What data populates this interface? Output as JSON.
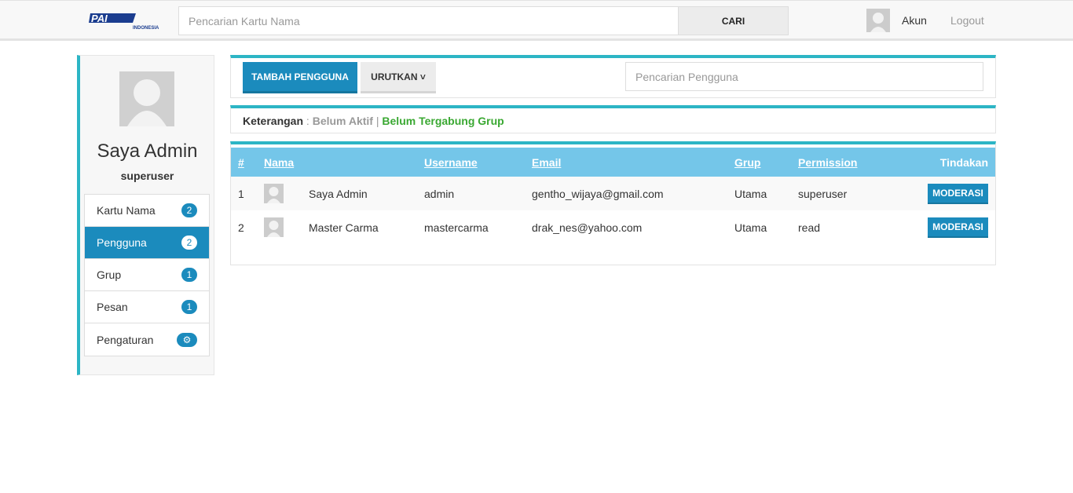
{
  "header": {
    "logo_text": "PAI",
    "logo_sub": "INDONESIA",
    "search_placeholder": "Pencarian Kartu Nama",
    "search_button": "CARI",
    "account_label": "Akun",
    "logout_label": "Logout"
  },
  "profile": {
    "name": "Saya Admin",
    "role": "superuser"
  },
  "sidebar": {
    "items": [
      {
        "label": "Kartu Nama",
        "badge": "2"
      },
      {
        "label": "Pengguna",
        "badge": "2",
        "active": true
      },
      {
        "label": "Grup",
        "badge": "1"
      },
      {
        "label": "Pesan",
        "badge": "1"
      },
      {
        "label": "Pengaturan",
        "badge": "⚙"
      }
    ]
  },
  "toolbar": {
    "add_user_label": "TAMBAH PENGGUNA",
    "sort_label": "URUTKAN ˅",
    "search_placeholder": "Pencarian Pengguna"
  },
  "legend": {
    "label": "Keterangan",
    "separator_colon": " : ",
    "inactive": "Belum Aktif",
    "separator_bar": " | ",
    "no_group": "Belum Tergabung Grup"
  },
  "table": {
    "headers": [
      "#",
      "Nama",
      "Username",
      "Email",
      "Grup",
      "Permission",
      "Tindakan"
    ],
    "rows": [
      {
        "no": "1",
        "name": "Saya Admin",
        "username": "admin",
        "email": "gentho_wijaya@gmail.com",
        "group": "Utama",
        "permission": "superuser",
        "action": "MODERASI"
      },
      {
        "no": "2",
        "name": "Master Carma",
        "username": "mastercarma",
        "email": "drak_nes@yahoo.com",
        "group": "Utama",
        "permission": "read",
        "action": "MODERASI"
      }
    ]
  },
  "colors": {
    "primary": "#1b8bbd",
    "accent": "#2cb5c5",
    "table_header": "#74c6e9",
    "green": "#3aa832"
  }
}
